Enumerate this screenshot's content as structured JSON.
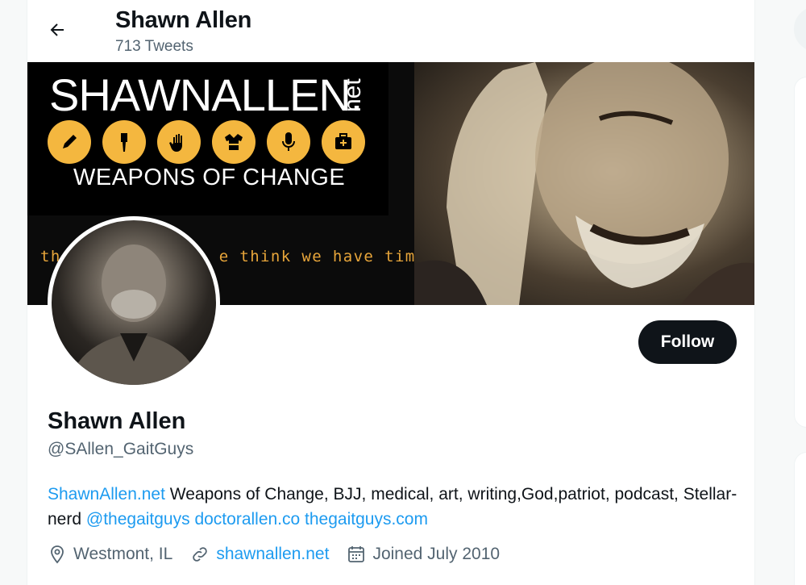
{
  "header": {
    "title": "Shawn Allen",
    "tweet_count": "713 Tweets"
  },
  "banner": {
    "brand": "SHAWNALLEN.",
    "brand_tld": "net",
    "tagline": "WEAPONS OF CHANGE",
    "quote_left": "th",
    "quote_right": "e think we have time."
  },
  "profile": {
    "name": "Shawn Allen",
    "handle": "@SAllen_GaitGuys",
    "follow_label": "Follow",
    "bio": {
      "link1": "ShawnAllen.net",
      "text1": " Weapons of Change, BJJ, medical, art, writing,God,patriot, podcast, Stellar-nerd ",
      "mention": "@thegaitguys",
      "link2": "doctorallen.co",
      "link3": "thegaitguys.com"
    },
    "location": "Westmont, IL",
    "website": "shawnallen.net",
    "joined": "Joined July 2010"
  },
  "colors": {
    "accent": "#1d9bf0",
    "badge": "#f4b73f",
    "text": "#0f1419",
    "muted": "#536471"
  },
  "icons": [
    "back-arrow-icon",
    "pencil-icon",
    "brush-icon",
    "hand-icon",
    "gi-icon",
    "microphone-icon",
    "medical-kit-icon",
    "location-icon",
    "link-icon",
    "calendar-icon"
  ]
}
